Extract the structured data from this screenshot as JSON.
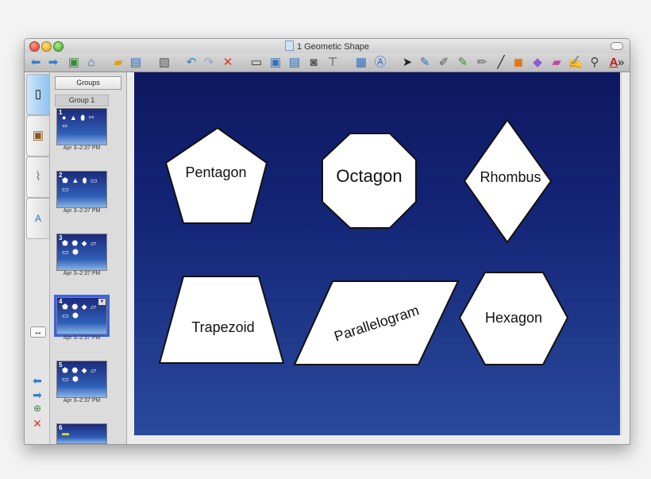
{
  "window": {
    "title": "1 Geometic Shape"
  },
  "toolbar": {
    "icons": [
      "back-arrow-icon",
      "forward-arrow-icon",
      "add-page-icon",
      "home-icon",
      "open-folder-icon",
      "save-icon",
      "paste-icon",
      "undo-icon",
      "redo-icon",
      "delete-icon",
      "screen-shade-icon",
      "display-icon",
      "capture-icon",
      "camera-icon",
      "doc-camera-icon",
      "table-icon",
      "spell-icon",
      "select-icon",
      "pen-icon",
      "creative-pen-icon",
      "magic-pen-icon",
      "highlighter-icon",
      "line-icon",
      "shape-icon",
      "fill-icon",
      "eraser-icon",
      "edit-icon",
      "magnifier-icon",
      "text-icon",
      "more-icon"
    ],
    "more_label": "»"
  },
  "side_tabs": [
    "page-sorter-icon",
    "gallery-icon",
    "attachments-icon",
    "properties-icon"
  ],
  "sorter": {
    "groups_label": "Groups",
    "group_name": "Group 1",
    "pages": [
      {
        "num": "1",
        "shapes": "● ▲ ⬮  ▭ ▭",
        "time": "Apr 3–2:37 PM"
      },
      {
        "num": "2",
        "shapes": "⬟ ▲ ⬮  ▭ ▭",
        "time": "Apr 3–2:37 PM"
      },
      {
        "num": "3",
        "shapes": "⬟ ⬣ ◆  ▱ ▭ ⬢",
        "time": "Apr 3–2:37 PM"
      },
      {
        "num": "4",
        "shapes": "⬟ ⬣ ◆  ▱ ▭ ⬢",
        "time": "Apr 3–2:37 PM"
      },
      {
        "num": "5",
        "shapes": "⬟ ⬣ ◆  ▱ ▭ ⬢",
        "time": "Apr 3–2:37 PM"
      },
      {
        "num": "6",
        "shapes": "▬",
        "time": ""
      }
    ]
  },
  "shapes": {
    "pentagon": "Pentagon",
    "octagon": "Octagon",
    "rhombus": "Rhombus",
    "trapezoid": "Trapezoid",
    "parallelogram": "Parallelogram",
    "hexagon": "Hexagon"
  },
  "colors": {
    "canvas_top": "#0e1860",
    "canvas_bottom": "#2a4a9c",
    "selected_thumb": "#3a62e6"
  }
}
